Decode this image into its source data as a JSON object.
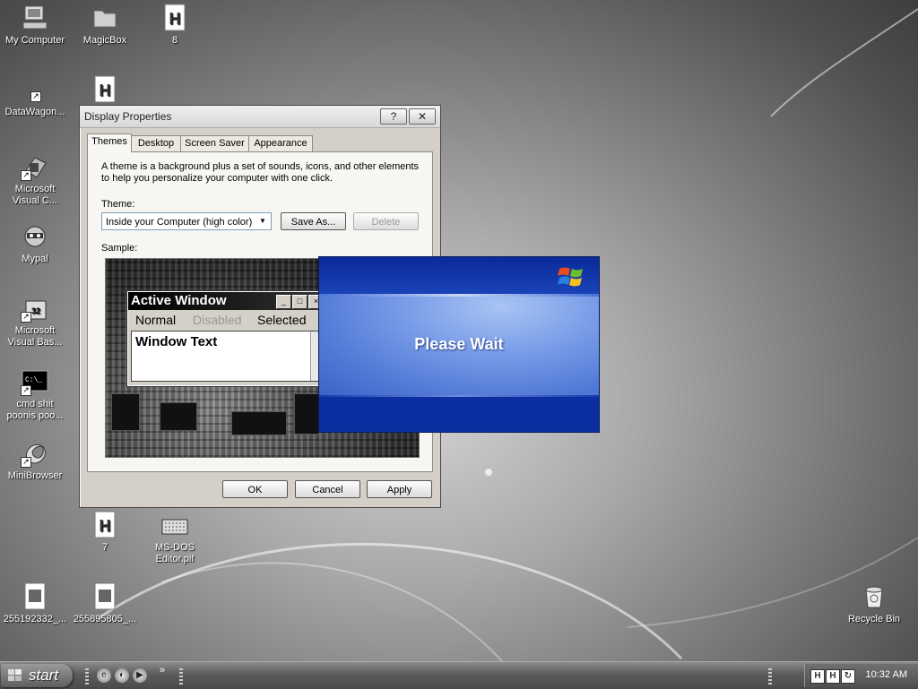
{
  "desktop_icons": [
    {
      "id": "my-computer",
      "label": "My Computer",
      "icon": "computer-icon"
    },
    {
      "id": "magicbox",
      "label": "MagicBox",
      "icon": "folder-icon"
    },
    {
      "id": "file-8",
      "label": "8",
      "icon": "h-document-icon"
    },
    {
      "id": "datawagon",
      "label": "DataWagon...",
      "icon": "shortcut-icon"
    },
    {
      "id": "file-h",
      "label": "",
      "icon": "h-document-icon"
    },
    {
      "id": "ms-visual-c",
      "label": "Microsoft Visual C...",
      "icon": "visual-studio-icon"
    },
    {
      "id": "mypal",
      "label": "Mypal",
      "icon": "raccoon-icon"
    },
    {
      "id": "ms-visual-basic",
      "label": "Microsoft Visual Bas...",
      "icon": "visual-basic-icon"
    },
    {
      "id": "cmd",
      "label": "cmd shit poonis poo...",
      "icon": "console-icon"
    },
    {
      "id": "minibrowser",
      "label": "MiniBrowser",
      "icon": "browser-icon"
    },
    {
      "id": "file-7",
      "label": "7",
      "icon": "h-document-icon"
    },
    {
      "id": "msdos-editor",
      "label": "MS-DOS Editor.pif",
      "icon": "keyboard-icon"
    },
    {
      "id": "img-1",
      "label": "255192332_...",
      "icon": "image-file-icon"
    },
    {
      "id": "img-2",
      "label": "255895805_...",
      "icon": "image-file-icon"
    },
    {
      "id": "recycle-bin",
      "label": "Recycle Bin",
      "icon": "recycle-bin-icon"
    }
  ],
  "display_properties": {
    "title": "Display Properties",
    "help_btn": "?",
    "close_btn": "✕",
    "tabs": [
      "Themes",
      "Desktop",
      "Screen Saver",
      "Appearance"
    ],
    "active_tab": "Themes",
    "description": "A theme is a background plus a set of sounds, icons, and other elements to help you personalize your computer with one click.",
    "theme_label": "Theme:",
    "theme_value": "Inside your Computer (high color)",
    "save_as": "Save As...",
    "delete": "Delete",
    "sample_label": "Sample:",
    "sample": {
      "active_window": "Active Window",
      "menu_normal": "Normal",
      "menu_disabled": "Disabled",
      "menu_selected": "Selected",
      "window_text": "Window Text"
    },
    "ok": "OK",
    "cancel": "Cancel",
    "apply": "Apply"
  },
  "please_wait": {
    "message": "Please Wait"
  },
  "taskbar": {
    "start": "start",
    "clock": "10:32 AM"
  },
  "colors": {
    "xp_blue_dark": "#0b2fa2",
    "xp_blue_light": "#7b9fe8",
    "dialog_face": "#d4d0c8"
  }
}
